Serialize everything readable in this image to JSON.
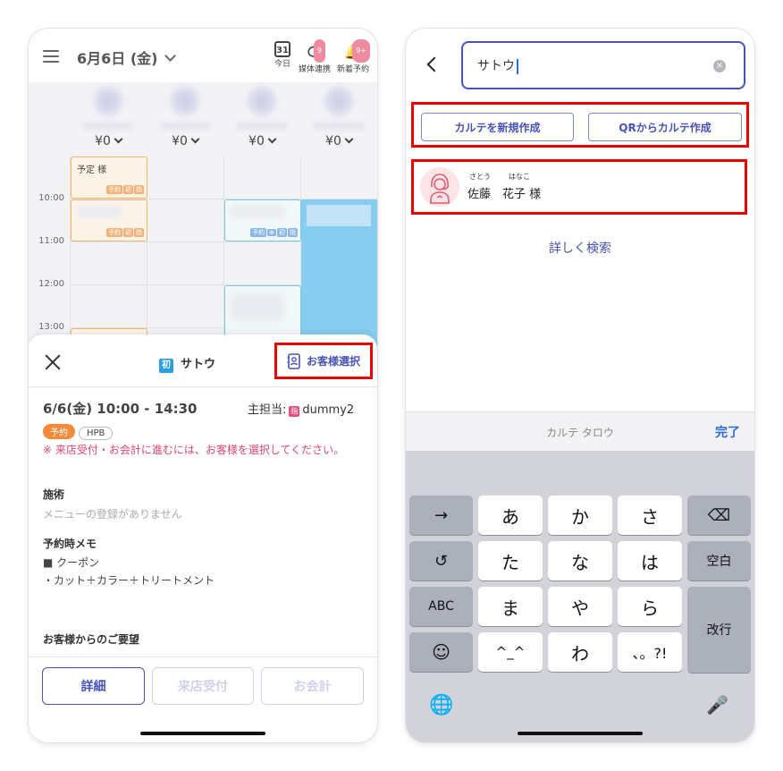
{
  "left": {
    "header": {
      "date": "6月6日 (金)",
      "icons": [
        {
          "name": "today",
          "label": "今日",
          "glyph": "31",
          "badge": ""
        },
        {
          "name": "media-sync",
          "label": "媒体連携",
          "glyph": "⟳",
          "badge": "9"
        },
        {
          "name": "new-booking",
          "label": "新着予約",
          "glyph": "🔔",
          "badge": "9+"
        }
      ]
    },
    "staff": [
      {
        "sales": "¥0"
      },
      {
        "sales": "¥0"
      },
      {
        "sales": "¥0"
      },
      {
        "sales": "¥0"
      }
    ],
    "times": [
      "10:00",
      "11:00",
      "12:00",
      "13:00"
    ],
    "events": {
      "e1": {
        "title": "予定 様",
        "tags": [
          "予約",
          "初",
          "指"
        ]
      },
      "e2": {
        "tags": [
          "予約",
          "初",
          "指"
        ]
      },
      "e3": {
        "tags": [
          "予約",
          "⊕",
          "初",
          "指"
        ]
      }
    },
    "sheet": {
      "first_badge": "初",
      "title": "サトウ",
      "customer_select": "お客様選択",
      "appointment_time": "6/6(金) 10:00 - 14:30",
      "staff_label": "主担当:",
      "staff_badge": "指",
      "staff_name": "dummy2",
      "chips": [
        "予約",
        "HPB"
      ],
      "warning": "※ 来店受付・お会計に進むには、お客様を選択してください。",
      "treatment_heading": "施術",
      "treatment_empty": "メニューの登録がありません",
      "memo_heading": "予約時メモ",
      "memo_line1": "■ クーポン",
      "memo_line2": "・カット＋カラー＋トリートメント",
      "request_heading": "お客様からのご要望",
      "buttons": [
        "詳細",
        "来店受付",
        "お会計"
      ]
    }
  },
  "right": {
    "search": {
      "value": "サトウ",
      "clear": "×"
    },
    "actions": [
      "カルテを新規作成",
      "QRからカルテ作成"
    ],
    "result": {
      "furigana_last": "さとう",
      "furigana_first": "はなこ",
      "name": "佐藤　花子 様"
    },
    "detail_search": "詳しく検索",
    "keyboard": {
      "suggestion": "カルテ タロウ",
      "done": "完了",
      "rows": [
        [
          "→",
          "あ",
          "か",
          "さ",
          "⌫"
        ],
        [
          "↺",
          "た",
          "な",
          "は",
          "空白"
        ],
        [
          "ABC",
          "ま",
          "や",
          "ら",
          "改行"
        ],
        [
          "☺",
          "^_^",
          "わ",
          "、。?!"
        ]
      ],
      "globe": "🌐",
      "mic": "🎤"
    }
  },
  "colors": {
    "accent": "#4753b8",
    "highlight": "#e00000",
    "warning": "#e0466e"
  }
}
